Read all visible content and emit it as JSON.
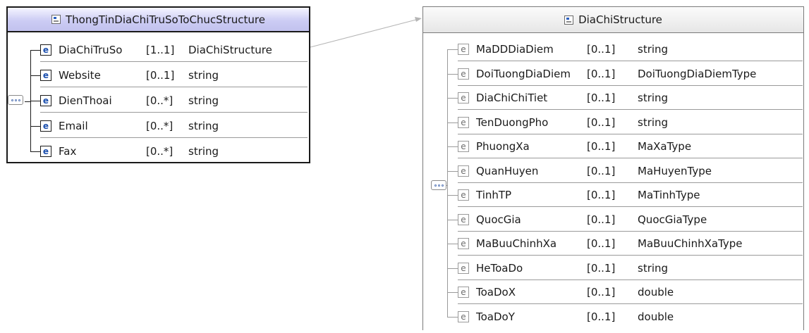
{
  "diagram": {
    "left_box": {
      "title": "ThongTinDiaChiTruSoToChucStructure",
      "elements": [
        {
          "name": "DiaChiTruSo",
          "card": "[1..1]",
          "type": "DiaChiStructure"
        },
        {
          "name": "Website",
          "card": "[0..1]",
          "type": "string"
        },
        {
          "name": "DienThoai",
          "card": "[0..*]",
          "type": "string"
        },
        {
          "name": "Email",
          "card": "[0..*]",
          "type": "string"
        },
        {
          "name": "Fax",
          "card": "[0..*]",
          "type": "string"
        }
      ]
    },
    "right_box": {
      "title": "DiaChiStructure",
      "elements": [
        {
          "name": "MaDDDiaDiem",
          "card": "[0..1]",
          "type": "string"
        },
        {
          "name": "DoiTuongDiaDiem",
          "card": "[0..1]",
          "type": "DoiTuongDiaDiemType"
        },
        {
          "name": "DiaChiChiTiet",
          "card": "[0..1]",
          "type": "string"
        },
        {
          "name": "TenDuongPho",
          "card": "[0..1]",
          "type": "string"
        },
        {
          "name": "PhuongXa",
          "card": "[0..1]",
          "type": "MaXaType"
        },
        {
          "name": "QuanHuyen",
          "card": "[0..1]",
          "type": "MaHuyenType"
        },
        {
          "name": "TinhTP",
          "card": "[0..1]",
          "type": "MaTinhType"
        },
        {
          "name": "QuocGia",
          "card": "[0..1]",
          "type": "QuocGiaType"
        },
        {
          "name": "MaBuuChinhXa",
          "card": "[0..1]",
          "type": "MaBuuChinhXaType"
        },
        {
          "name": "HeToaDo",
          "card": "[0..1]",
          "type": "string"
        },
        {
          "name": "ToaDoX",
          "card": "[0..1]",
          "type": "double"
        },
        {
          "name": "ToaDoY",
          "card": "[0..1]",
          "type": "double"
        }
      ]
    },
    "element_icon_letter": "e",
    "icons": {
      "complex_type": "complex-type-icon",
      "element": "element-icon",
      "sequence": "sequence-compositor-icon"
    },
    "colors": {
      "left_header": "#c9c9f2",
      "right_header": "#e8e8e8",
      "icon_letter": "#1b4fae"
    }
  }
}
